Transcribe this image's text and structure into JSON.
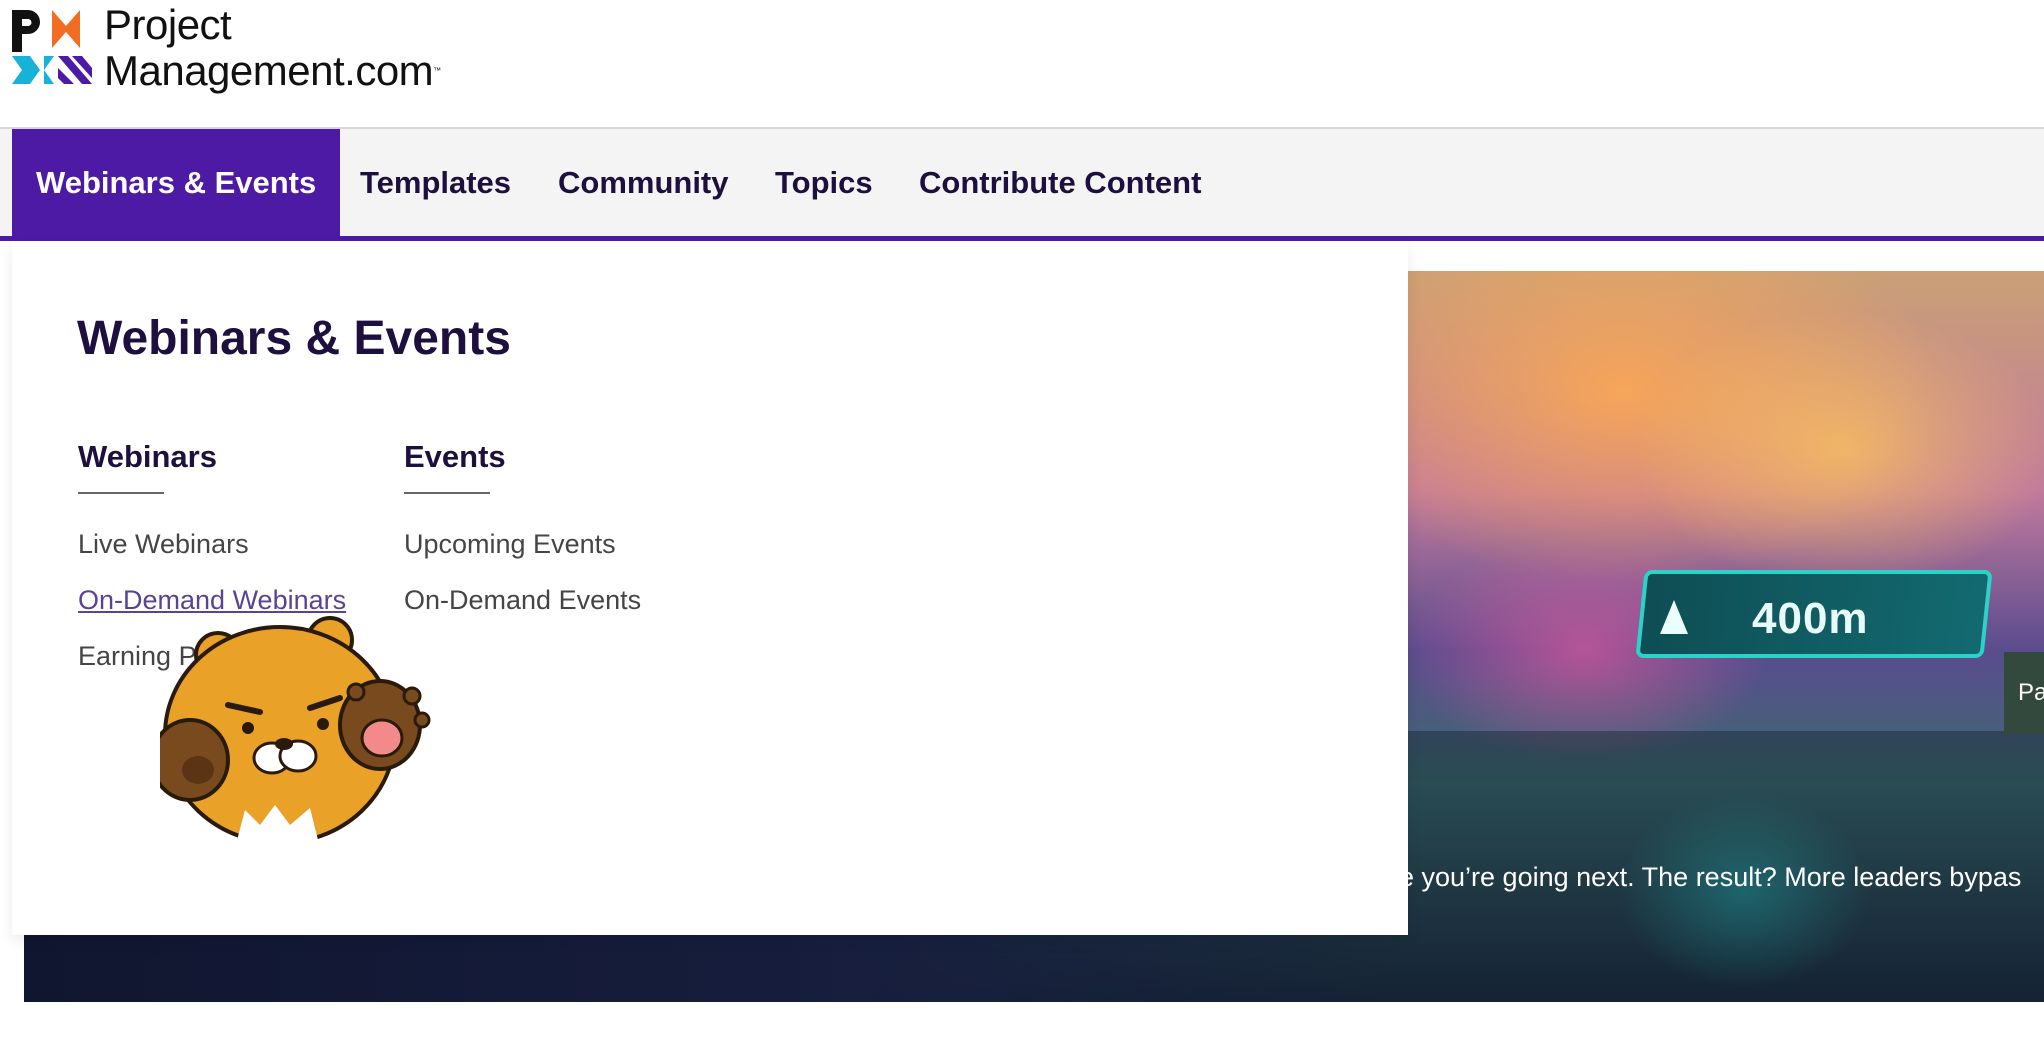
{
  "brand": {
    "line1": "Project",
    "line2": "Management.com",
    "tm": "™",
    "colors": {
      "orange": "#f26c21",
      "cyan": "#17b2d8",
      "purple": "#4d1aa5",
      "dark": "#1d0f3e"
    }
  },
  "nav": {
    "items": [
      {
        "label": "Webinars & Events",
        "active": true
      },
      {
        "label": "Templates"
      },
      {
        "label": "Community"
      },
      {
        "label": "Topics"
      },
      {
        "label": "Contribute Content"
      }
    ]
  },
  "dropdown": {
    "title": "Webinars & Events",
    "columns": [
      {
        "heading": "Webinars",
        "links": [
          "Live Webinars",
          "On-Demand Webinars",
          "Earning PD"
        ]
      },
      {
        "heading": "Events",
        "links": [
          "Upcoming Events",
          "On-Demand Events"
        ]
      }
    ],
    "hovered_link": "On-Demand Webinars"
  },
  "hero": {
    "sign_text": "400m",
    "caption": "re you’re going next. The result? More leaders bypas",
    "side_tab": "Pa"
  },
  "sticker": {
    "icon": "bear-sticker-icon"
  }
}
